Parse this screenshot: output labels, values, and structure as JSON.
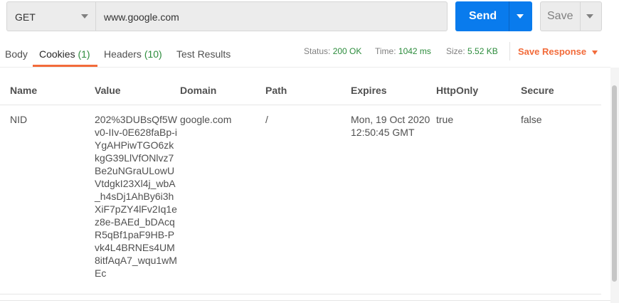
{
  "request": {
    "method": "GET",
    "url": "www.google.com",
    "send_label": "Send",
    "save_label": "Save"
  },
  "tabs": [
    {
      "label": "Body",
      "count": ""
    },
    {
      "label": "Cookies",
      "count": "(1)"
    },
    {
      "label": "Headers",
      "count": "(10)"
    },
    {
      "label": "Test Results",
      "count": ""
    }
  ],
  "active_tab": "Cookies",
  "response_meta": {
    "status_label": "Status:",
    "status_value": "200 OK",
    "time_label": "Time:",
    "time_value": "1042 ms",
    "size_label": "Size:",
    "size_value": "5.52 KB",
    "save_response_label": "Save Response"
  },
  "cookies_table": {
    "columns": [
      "Name",
      "Value",
      "Domain",
      "Path",
      "Expires",
      "HttpOnly",
      "Secure"
    ],
    "rows": [
      {
        "name": "NID",
        "value": "202%3DUBsQf5Wv0-IIv-0E628faBp-iYgAHPiwTGO6zkkgG39LlVfONlvz7Be2uNGraULowUVtdgkI23Xl4j_wbA_h4sDj1AhBy6i3hXiF7pZY4lFv2Iq1ez8e-BAEd_bDAcqR5qBf1paF9HB-Pvk4L4BRNEs4UM8itfAqA7_wqu1wMEc",
        "domain": "google.com",
        "path": "/",
        "expires": "Mon, 19 Oct 2020 12:50:45 GMT",
        "httponly": "true",
        "secure": "false"
      }
    ]
  },
  "colors": {
    "accent_blue": "#097bed",
    "accent_orange": "#f26b3a",
    "success_green": "#2c8c3c"
  }
}
